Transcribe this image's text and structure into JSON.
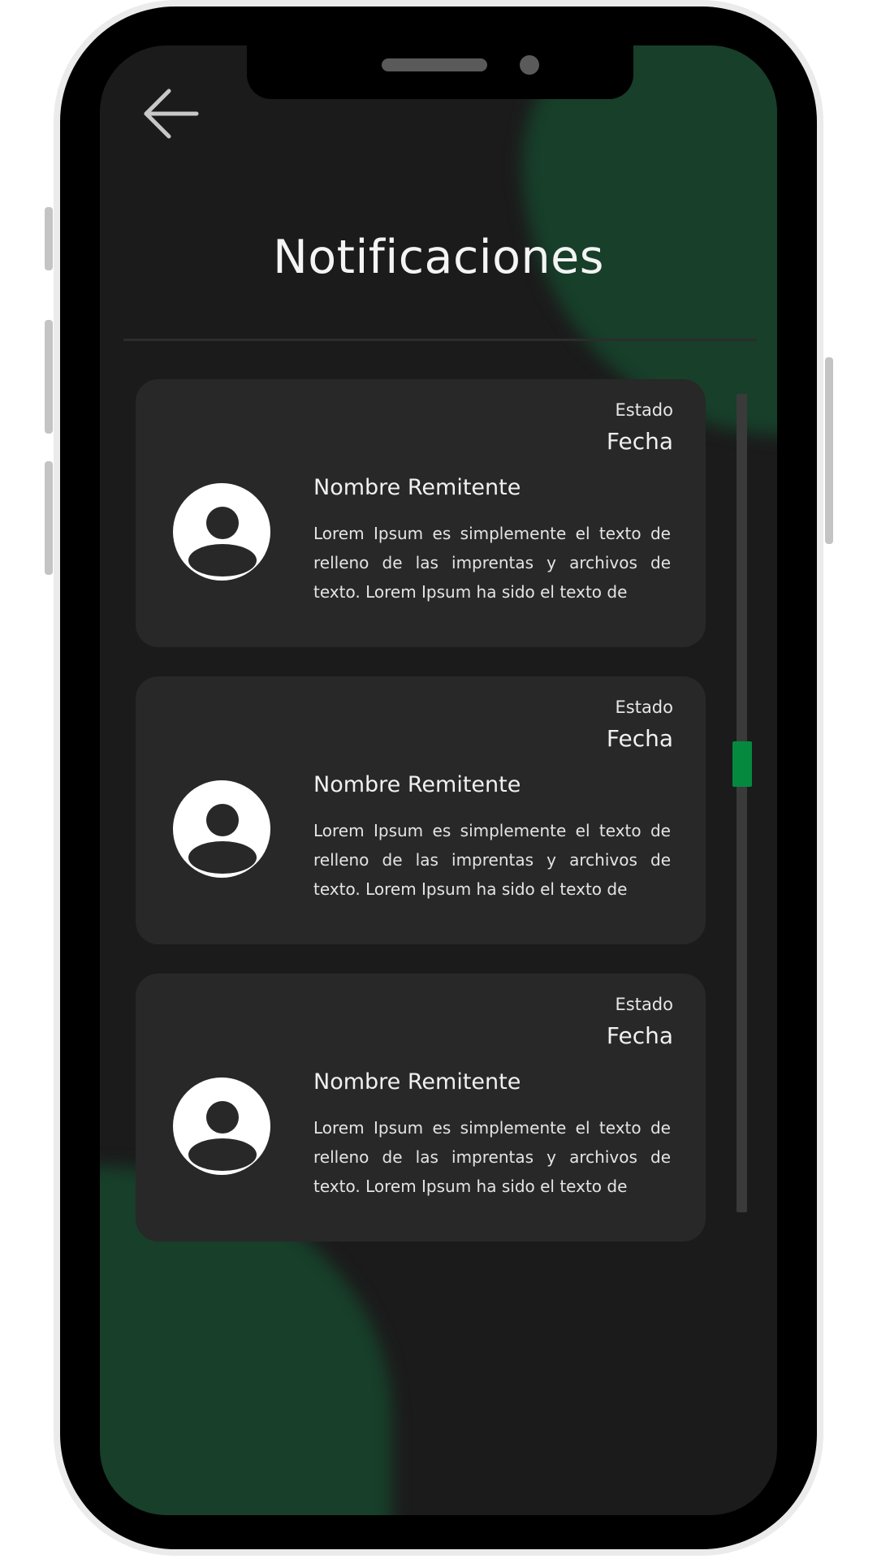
{
  "header": {
    "back_icon": "arrow-left-icon",
    "title": "Notificaciones"
  },
  "notifications": [
    {
      "status": "Estado",
      "date": "Fecha",
      "sender": "Nombre Remitente",
      "message": "Lorem Ipsum es simplemente el texto de relleno de las imprentas y archivos de texto. Lorem Ipsum ha sido el texto de",
      "avatar_icon": "user-avatar-icon"
    },
    {
      "status": "Estado",
      "date": "Fecha",
      "sender": "Nombre Remitente",
      "message": "Lorem Ipsum es simplemente el texto de relleno de las imprentas y archivos de texto. Lorem Ipsum ha sido el texto de",
      "avatar_icon": "user-avatar-icon"
    },
    {
      "status": "Estado",
      "date": "Fecha",
      "sender": "Nombre Remitente",
      "message": "Lorem Ipsum es simplemente el texto de relleno de las imprentas y archivos de texto. Lorem Ipsum ha sido el texto de",
      "avatar_icon": "user-avatar-icon"
    }
  ],
  "scrollbar": {
    "position_fraction": 0.45
  },
  "colors": {
    "background": "#1b1b1b",
    "card": "#282828",
    "accent_green": "#05893f",
    "blob_green": "#173f2a",
    "text": "#f0f0f0"
  }
}
